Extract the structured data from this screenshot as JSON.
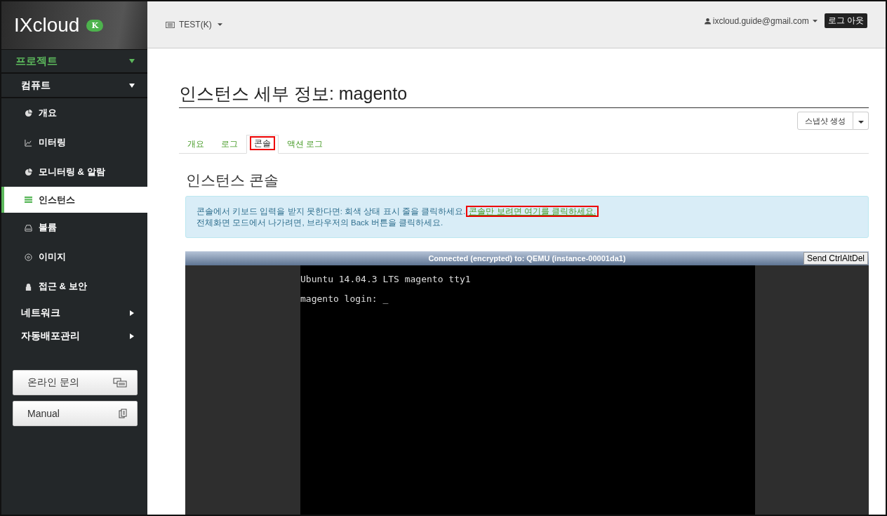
{
  "brand": {
    "name": "IXcloud",
    "badge": "K"
  },
  "sidebar": {
    "sections": [
      {
        "label": "프로젝트",
        "expanded": true,
        "kind": "project"
      },
      {
        "label": "컴퓨트",
        "expanded": true,
        "kind": "group",
        "items": [
          {
            "label": "개요",
            "selected": false
          },
          {
            "label": "미터링",
            "selected": false
          },
          {
            "label": "모니터링 & 알람",
            "selected": false
          },
          {
            "label": "인스턴스",
            "selected": true
          },
          {
            "label": "볼륨",
            "selected": false
          },
          {
            "label": "이미지",
            "selected": false
          },
          {
            "label": "접근 & 보안",
            "selected": false
          }
        ]
      },
      {
        "label": "네트워크",
        "expanded": false,
        "kind": "group"
      },
      {
        "label": "자동배포관리",
        "expanded": false,
        "kind": "group"
      }
    ],
    "buttons": [
      "온라인 문의",
      "Manual"
    ]
  },
  "topbar": {
    "project": "TEST(K)",
    "user": "ixcloud.guide@gmail.com",
    "logout": "로그 아웃"
  },
  "page": {
    "title": "인스턴스 세부 정보: magento",
    "action": "스냅샷 생성",
    "tabs": [
      {
        "label": "개요",
        "selected": false,
        "highlighted": false
      },
      {
        "label": "로그",
        "selected": false,
        "highlighted": false
      },
      {
        "label": "콘솔",
        "selected": true,
        "highlighted": true
      },
      {
        "label": "액션 로그",
        "selected": false,
        "highlighted": false
      }
    ],
    "section_title": "인스턴스 콘솔",
    "info": {
      "line1": "콘솔에서 키보드 입력을 받지 못한다면: 회색 상태 표시 줄을 클릭하세요.",
      "link": "콘솔만 보려면 여기를 클릭하세요.",
      "link_highlighted": true,
      "line2": "전체화면 모드에서 나가려면, 브라우저의 Back 버튼을 클릭하세요."
    },
    "console": {
      "status": "Connected (encrypted) to: QEMU (instance-00001da1)",
      "button": "Send CtrlAltDel",
      "lines": [
        "Ubuntu 14.04.3 LTS magento tty1",
        "magento login: _"
      ]
    }
  }
}
